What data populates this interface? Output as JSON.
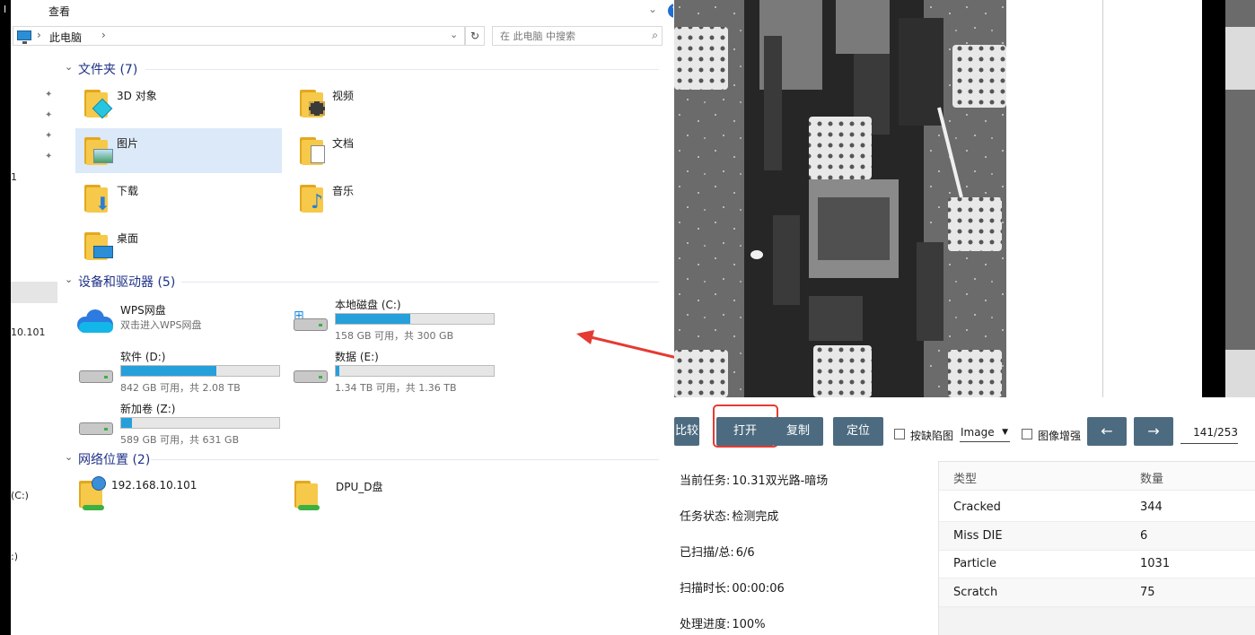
{
  "explorer": {
    "menu": {
      "view": "查看"
    },
    "address": {
      "location": "此电脑",
      "search_placeholder": "在 此电脑 中搜索"
    },
    "left_strip": {
      "labels": [
        "l",
        "1",
        "10.101",
        "(C:)",
        ":)"
      ]
    },
    "groups": {
      "folders": {
        "title": "文件夹 (7)",
        "items": [
          "3D 对象",
          "视频",
          "图片",
          "文档",
          "下载",
          "音乐",
          "桌面"
        ]
      },
      "devices": {
        "title": "设备和驱动器 (5)",
        "wps": {
          "name": "WPS网盘",
          "subtitle": "双击进入WPS网盘"
        },
        "drives": [
          {
            "name": "本地磁盘 (C:)",
            "info": "158 GB 可用，共 300 GB",
            "used_fraction": 0.47
          },
          {
            "name": "软件 (D:)",
            "info": "842 GB 可用，共 2.08 TB",
            "used_fraction": 0.6
          },
          {
            "name": "数据 (E:)",
            "info": "1.34 TB 可用，共 1.36 TB",
            "used_fraction": 0.02
          },
          {
            "name": "新加卷 (Z:)",
            "info": "589 GB 可用，共 631 GB",
            "used_fraction": 0.07
          }
        ]
      },
      "network": {
        "title": "网络位置 (2)",
        "items": [
          "192.168.10.101",
          "DPU_D盘"
        ]
      }
    }
  },
  "inspector": {
    "toolbar": {
      "compare_label": "比较",
      "open_label": "打开",
      "copy_label": "复制",
      "locate_label": "定位",
      "defect_chk_label": "按缺陷图",
      "image_select": "Image",
      "enhance_chk_label": "图像增强",
      "prev_label": "←",
      "next_label": "→",
      "page": "141/253"
    },
    "info": {
      "task_label": "当前任务:",
      "task_value": "10.31双光路-暗场",
      "status_label": "任务状态:",
      "status_value": "检测完成",
      "scanned_label": "已扫描/总:",
      "scanned_value": "6/6",
      "duration_label": "扫描时长:",
      "duration_value": "00:00:06",
      "progress_label": "处理进度:",
      "progress_value": "100%"
    },
    "table": {
      "headers": [
        "类型",
        "数量"
      ],
      "rows": [
        {
          "type": "Cracked",
          "count": "344"
        },
        {
          "type": "Miss DIE",
          "count": "6"
        },
        {
          "type": "Particle",
          "count": "1031"
        },
        {
          "type": "Scratch",
          "count": "75"
        }
      ]
    }
  },
  "colors": {
    "accent_button": "#4d6b80",
    "highlight": "#e43b33",
    "drive_fill": "#26a0da",
    "group_title": "#1e3287"
  }
}
